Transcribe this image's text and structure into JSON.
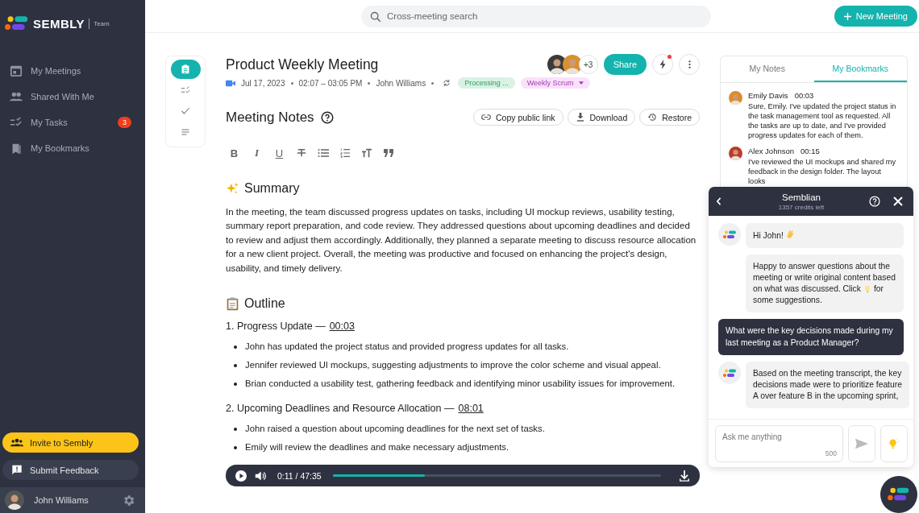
{
  "sidebar": {
    "brand": "SEMBLY",
    "plan": "Team",
    "nav": [
      {
        "label": "My Meetings"
      },
      {
        "label": "Shared With Me"
      },
      {
        "label": "My Tasks",
        "badge": "3"
      },
      {
        "label": "My Bookmarks"
      }
    ],
    "invite": "Invite to Sembly",
    "feedback": "Submit Feedback",
    "user": "John Williams"
  },
  "topbar": {
    "search_placeholder": "Cross-meeting search",
    "new_meeting": "New Meeting"
  },
  "rail": [
    {
      "selected": true
    },
    {
      "selected": false
    },
    {
      "selected": false
    },
    {
      "selected": false
    }
  ],
  "meeting": {
    "title": "Product Weekly Meeting",
    "date": "Jul 17, 2023",
    "time": "02:07 – 03:05 PM",
    "owner": "John Williams",
    "status": "Processing ...",
    "tag": "Weekly Scrum",
    "participants_more": "+3",
    "share": "Share",
    "notification": true
  },
  "notes": {
    "title": "Meeting Notes",
    "actions": [
      {
        "label": "Copy public link"
      },
      {
        "label": "Download"
      },
      {
        "label": "Restore"
      }
    ],
    "toolbar": [
      {
        "kind": "bold",
        "label": "B"
      },
      {
        "kind": "italic",
        "label": "I"
      },
      {
        "kind": "underline",
        "label": "U"
      },
      {
        "kind": "strike"
      },
      {
        "kind": "bullets"
      },
      {
        "kind": "numbers"
      },
      {
        "kind": "textsize"
      },
      {
        "kind": "quote"
      }
    ],
    "summary_title": "Summary",
    "summary": "In the meeting, the team discussed progress updates on tasks, including UI mockup reviews, usability testing, summary report preparation, and code review. They addressed questions about upcoming deadlines and decided to review and adjust them accordingly. Additionally, they planned a separate meeting to discuss resource allocation for a new client project. Overall, the meeting was productive and focused on enhancing the project's design, usability, and timely delivery.",
    "outline_title": "Outline",
    "sections": [
      {
        "title": "1. Progress Update —",
        "time": "00:03",
        "points": [
          "John has updated the project status and provided progress updates for all tasks.",
          "Jennifer reviewed UI mockups, suggesting adjustments to improve the color scheme and visual appeal.",
          "Brian conducted a usability test, gathering feedback and identifying minor usability issues for improvement."
        ]
      },
      {
        "title": "2. Upcoming Deadlines and Resource Allocation —",
        "time": "08:01",
        "points": [
          "John raised a question about upcoming deadlines for the next set of tasks.",
          "Emily will review the deadlines and make necessary adjustments."
        ]
      }
    ]
  },
  "player": {
    "time": "0:11 / 47:35",
    "level": 0.28
  },
  "panel": {
    "tabs": [
      {
        "label": "My Notes",
        "selected": false
      },
      {
        "label": "My Bookmarks",
        "selected": true
      }
    ],
    "bookmarks": [
      {
        "name": "Emily Davis",
        "time": "00:03",
        "text": "Sure, Emily. I've updated the project status in the task management tool as requested. All the tasks are up to date, and I've provided progress updates for each of them."
      },
      {
        "name": "Alex Johnson",
        "time": "00:15",
        "text": "I've reviewed the UI mockups and shared my feedback in the design folder. The layout looks"
      }
    ]
  },
  "chat": {
    "title": "Semblian",
    "credits": "1357 credits left",
    "messages": [
      {
        "kind": "bot",
        "lines": [
          [
            {
              "kind": "text",
              "text": "Hi John!"
            },
            {
              "kind": "wave"
            }
          ]
        ]
      },
      {
        "kind": "bot",
        "lines": [
          [
            {
              "kind": "text",
              "text": "Happy to answer questions about the"
            }
          ],
          [
            {
              "kind": "text",
              "text": "meeting or write original content based"
            }
          ],
          [
            {
              "kind": "text",
              "text": "on what was discussed. Click"
            },
            {
              "kind": "bulb"
            },
            {
              "kind": "text",
              "text": "for"
            }
          ],
          [
            {
              "kind": "text",
              "text": "some suggestions."
            }
          ]
        ]
      },
      {
        "kind": "user",
        "lines": [
          [
            {
              "kind": "text",
              "text": "What were the key decisions made during my last meeting as a Product Manager?"
            }
          ]
        ]
      },
      {
        "kind": "bot",
        "lines": [
          [
            {
              "kind": "text",
              "text": "Based on the meeting transcript, the key"
            }
          ],
          [
            {
              "kind": "text",
              "text": "decisions made were to prioritize feature"
            }
          ],
          [
            {
              "kind": "text",
              "text": "A over feature B in the upcoming sprint,"
            }
          ]
        ]
      }
    ],
    "input_placeholder": "Ask me anything",
    "char_limit": "500"
  }
}
